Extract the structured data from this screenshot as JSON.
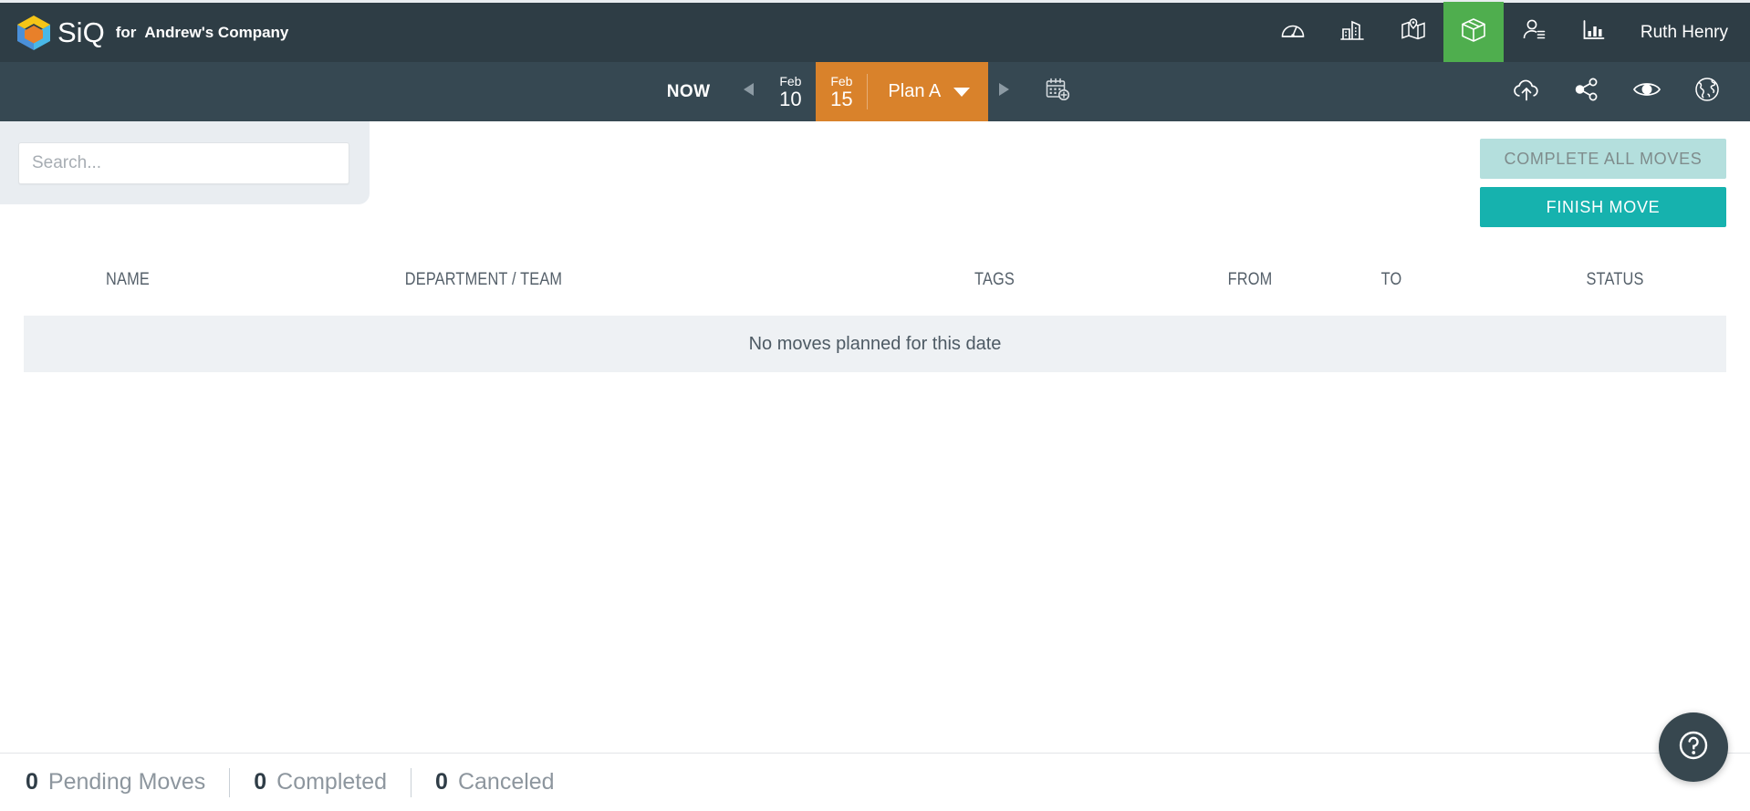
{
  "header": {
    "brand_mark": "siq-cube-logo",
    "wordmark": "SiQ",
    "for_label": "for",
    "company": "Andrew's Company",
    "nav": [
      {
        "name": "dashboard",
        "icon": "gauge-icon"
      },
      {
        "name": "buildings",
        "icon": "buildings-icon"
      },
      {
        "name": "floorplan",
        "icon": "map-pin-icon"
      },
      {
        "name": "moves",
        "icon": "box-icon",
        "active": true
      },
      {
        "name": "people",
        "icon": "person-list-icon"
      },
      {
        "name": "reports",
        "icon": "bar-chart-icon"
      }
    ],
    "user": "Ruth Henry",
    "active_color": "#4fae4e",
    "bar_color": "#2e3d45"
  },
  "toolbar": {
    "now_label": "NOW",
    "prev_icon": "triangle-left-icon",
    "next_icon": "triangle-right-icon",
    "date_prev": {
      "month": "Feb",
      "day": "10"
    },
    "date_current": {
      "month": "Feb",
      "day": "15"
    },
    "plan_label": "Plan A",
    "plan_caret": "chevron-down-icon",
    "calendar_icon": "calendar-add-icon",
    "accent_color": "#d9822b",
    "right_icons": [
      {
        "name": "cloud-upload",
        "icon": "cloud-upload-icon"
      },
      {
        "name": "share",
        "icon": "share-icon"
      },
      {
        "name": "view",
        "icon": "eye-icon"
      },
      {
        "name": "globe",
        "icon": "globe-icon"
      }
    ]
  },
  "search": {
    "value": "",
    "placeholder": "Search..."
  },
  "buttons": {
    "complete_all": "COMPLETE ALL MOVES",
    "finish_move": "FINISH MOVE",
    "primary_color": "#16b2ae",
    "disabled_color": "#b4dfdd"
  },
  "table": {
    "columns": [
      {
        "key": "name",
        "label": "NAME"
      },
      {
        "key": "dept",
        "label": "DEPARTMENT / TEAM"
      },
      {
        "key": "tags",
        "label": "TAGS"
      },
      {
        "key": "from",
        "label": "FROM"
      },
      {
        "key": "to",
        "label": "TO"
      },
      {
        "key": "status",
        "label": "STATUS"
      }
    ],
    "rows": [],
    "empty_message": "No moves planned for this date"
  },
  "statusbar": {
    "stats": [
      {
        "count": "0",
        "label": "Pending Moves"
      },
      {
        "count": "0",
        "label": "Completed"
      },
      {
        "count": "0",
        "label": "Canceled"
      }
    ]
  },
  "help": {
    "icon": "question-mark-icon"
  }
}
